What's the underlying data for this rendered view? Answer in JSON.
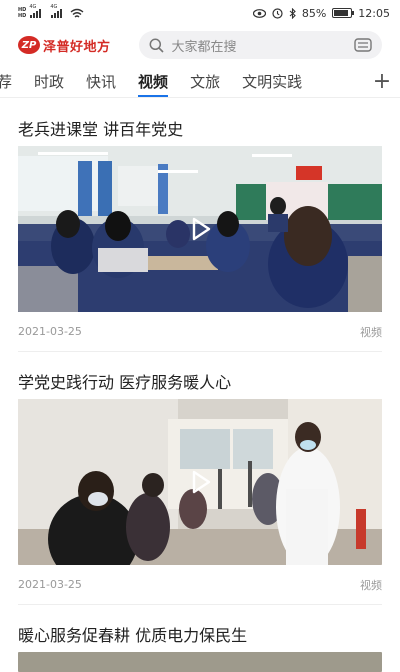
{
  "status_bar": {
    "network_tags": [
      "HD",
      "HD"
    ],
    "signal_tags": [
      "4G",
      "4G"
    ],
    "battery_percent_text": "85%",
    "battery_level": 0.85,
    "time": "12:05"
  },
  "header": {
    "logo_mark": "ZP",
    "app_name": "泽普好地方",
    "search_placeholder": "大家都在搜"
  },
  "tabs": {
    "items": [
      "荐",
      "时政",
      "快讯",
      "视频",
      "文旅",
      "文明实践"
    ],
    "active_index": 3,
    "more_label": "+"
  },
  "feed": {
    "articles": [
      {
        "title": "老兵进课堂 讲百年党史",
        "date": "2021-03-25",
        "type": "视频"
      },
      {
        "title": "学党史践行动 医疗服务暖人心",
        "date": "2021-03-25",
        "type": "视频"
      },
      {
        "title": "暖心服务促春耕 优质电力保民生"
      }
    ]
  },
  "colors": {
    "brand_red": "#d42b25",
    "accent_blue": "#1a73e8"
  }
}
